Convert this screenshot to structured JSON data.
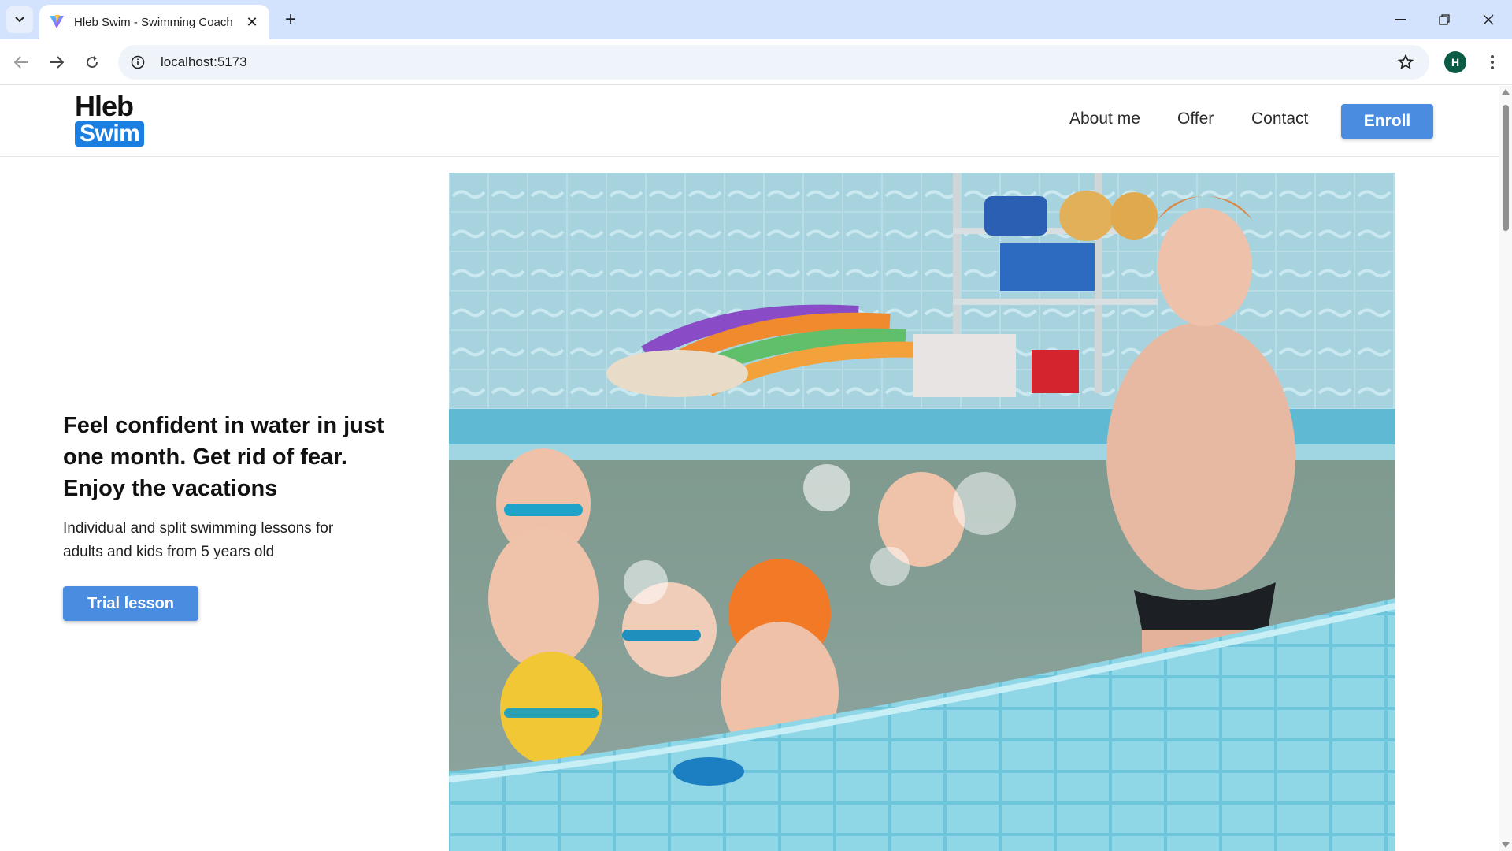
{
  "browser": {
    "tab_title": "Hleb Swim - Swimming Coach",
    "url": "localhost:5173",
    "profile_initial": "H"
  },
  "site": {
    "logo_top": "Hleb",
    "logo_bottom": "Swim",
    "nav": [
      "About me",
      "Offer",
      "Contact"
    ],
    "enroll_label": "Enroll"
  },
  "hero": {
    "title_lines": [
      "Feel confident in water in just",
      "one month. Get rid of fear.",
      "Enjoy the vacations"
    ],
    "subtitle_lines": [
      "Individual and split swimming lessons for",
      "adults and kids from 5 years old"
    ],
    "cta_label": "Trial lesson"
  },
  "colors": {
    "accent": "#4a8de0",
    "logo_blue": "#1a7fe0",
    "tabbar": "#d3e3fd"
  }
}
